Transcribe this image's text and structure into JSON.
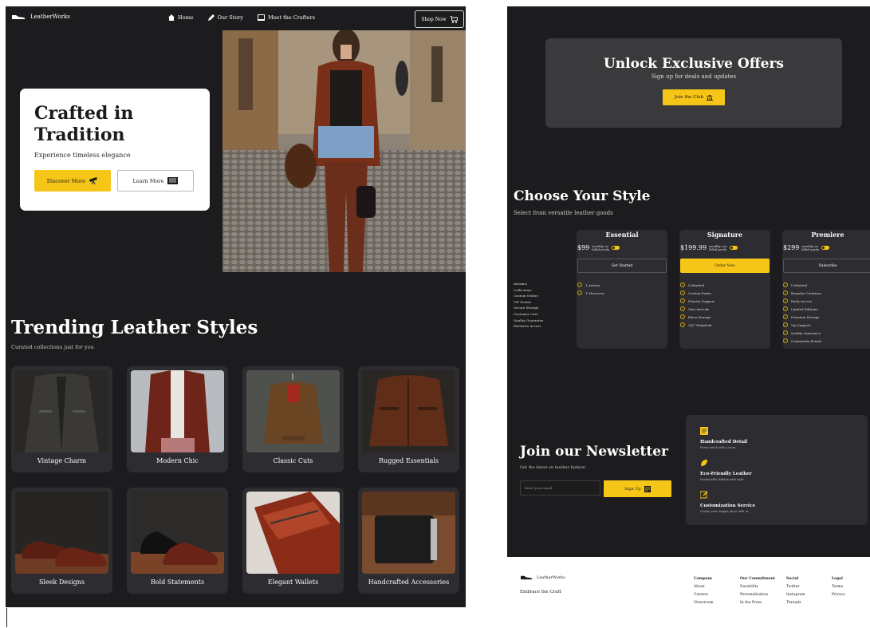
{
  "nav": {
    "brand": "LeatherWorks",
    "links": [
      "Home",
      "Our Story",
      "Meet the Crafters"
    ],
    "shop_label": "Shop Now"
  },
  "hero": {
    "title_line1": "Crafted in",
    "title_line2": "Tradition",
    "subtitle": "Experience timeless elegance",
    "primary_label": "Discover More",
    "secondary_label": "Learn More"
  },
  "trending": {
    "title": "Trending Leather Styles",
    "subtitle": "Curated collections just for you",
    "items": [
      "Vintage Charm",
      "Modern Chic",
      "Classic Cuts",
      "Rugged Essentials",
      "Sleek Designs",
      "Bold Statements",
      "Elegant Wallets",
      "Handcrafted Accessories"
    ]
  },
  "offers": {
    "title": "Unlock Exclusive Offers",
    "subtitle": "Sign up for deals and updates",
    "button_label": "Join the Club"
  },
  "pricing": {
    "title": "Choose Your Style",
    "subtitle": "Select from versatile leather goods",
    "features": [
      "Artisans",
      "Collections",
      "Custom Orders",
      "VIP Events",
      "Secure Storage",
      "Customer Care",
      "Quality Guarantee",
      "Exclusive Access"
    ],
    "plans": [
      {
        "name": "Essential",
        "price": "$99",
        "note_line1": "monthly, no",
        "note_line2": "billed yearly",
        "button": "Get Started",
        "items": [
          "1 Artisan",
          "1 Showcase"
        ]
      },
      {
        "name": "Signature",
        "price": "$199.99",
        "note_line1": "monthly, can",
        "note_line2": "billed yearly",
        "button": "Order Now",
        "items": [
          "Unlimited",
          "Custom Prints",
          "Priority Support",
          "Vine Arrivals",
          "Extra Storage",
          "24/7 Helpdesk"
        ]
      },
      {
        "name": "Premiere",
        "price": "$299",
        "note_line1": "monthly, no",
        "note_line2": "billed yearly",
        "button": "Subscribe",
        "items": [
          "Unlimited",
          "Bespoke Creations",
          "Early Access",
          "Limited Editions",
          "Premium Storage",
          "Vip Support",
          "Quality Assurance",
          "Community Events"
        ]
      }
    ]
  },
  "newsletter": {
    "title": "Join our Newsletter",
    "subtitle": "Get the latest on leather fashion",
    "placeholder": "Enter your email",
    "button_label": "Sign Up"
  },
  "benefits": [
    {
      "title": "Handcrafted Detail",
      "desc": "Every stitch tells a story"
    },
    {
      "title": "Eco-Friendly Leather",
      "desc": "Sustainable fashion with style"
    },
    {
      "title": "Customization Service",
      "desc": "Create your unique piece with us"
    }
  ],
  "footer": {
    "brand": "LeatherWorks",
    "tagline": "Embrace the Craft",
    "columns": [
      {
        "heading": "Company",
        "links": [
          "About",
          "Careers",
          "Newsroom"
        ]
      },
      {
        "heading": "Our Commitment",
        "links": [
          "Durability",
          "Personalization",
          "In the Press"
        ]
      },
      {
        "heading": "Social",
        "links": [
          "Twitter",
          "Instagram",
          "Threads"
        ]
      },
      {
        "heading": "Legal",
        "links": [
          "Terms",
          "Privacy"
        ]
      }
    ]
  },
  "colors": {
    "background": "#1c1b1e",
    "card": "#2d2c30",
    "accent": "#f5c518"
  }
}
